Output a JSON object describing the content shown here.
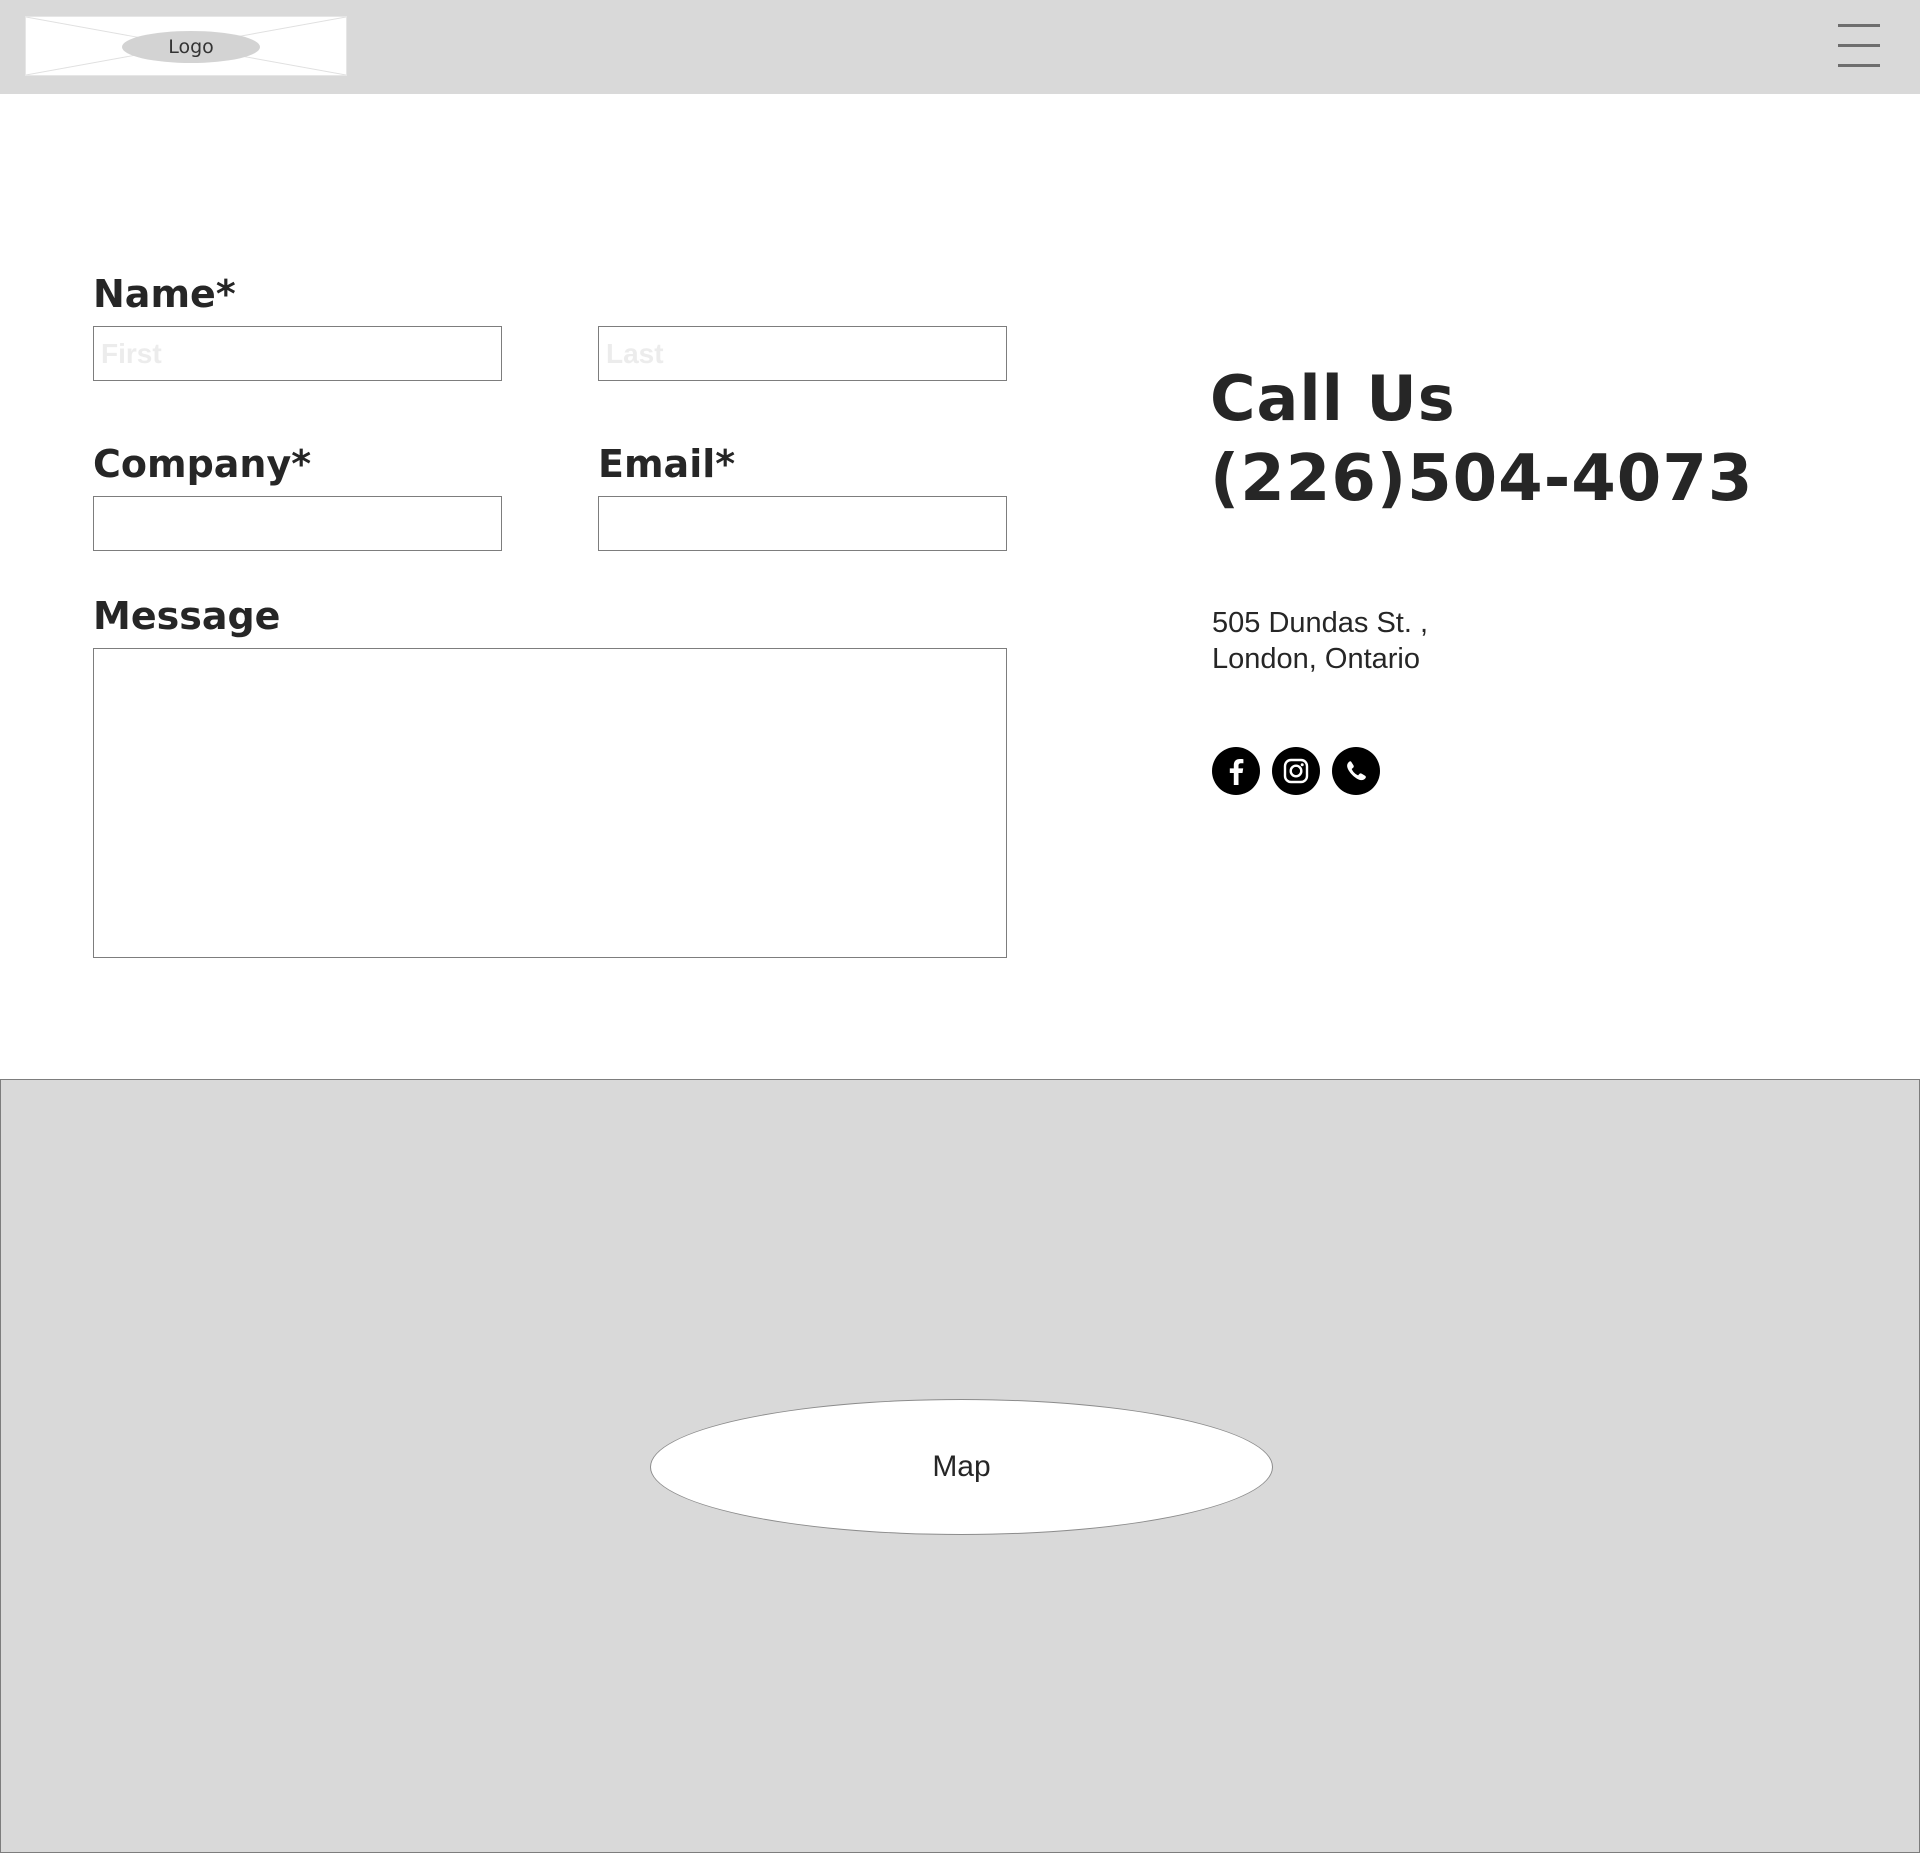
{
  "header": {
    "logo_text": "Logo",
    "menu_icon": "hamburger-menu-icon"
  },
  "form": {
    "name_label": "Name*",
    "first_placeholder": "First",
    "last_placeholder": "Last",
    "company_label": "Company*",
    "email_label": "Email*",
    "message_label": "Message"
  },
  "contact": {
    "call_title": "Call Us",
    "phone": "(226)504-4073",
    "address_line1": "505 Dundas St. ,",
    "address_line2": "London, Ontario",
    "social_icons": [
      "facebook-icon",
      "instagram-icon",
      "whatsapp-icon"
    ]
  },
  "map": {
    "label": "Map"
  },
  "colors": {
    "header_bg": "#d9d9d9",
    "map_bg": "#d9d9d9",
    "text": "#262626",
    "border": "#7d7d7d"
  }
}
